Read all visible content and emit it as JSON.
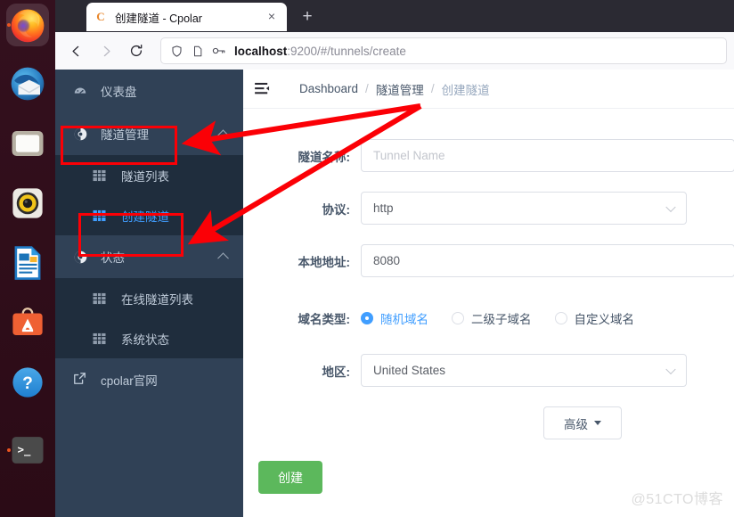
{
  "dock": {
    "items": [
      {
        "name": "firefox",
        "label": "Firefox",
        "running": true,
        "active": true
      },
      {
        "name": "thunderbird",
        "label": "Thunderbird Mail",
        "running": false,
        "active": false
      },
      {
        "name": "files",
        "label": "Files",
        "running": false,
        "active": false
      },
      {
        "name": "rhythmbox",
        "label": "Rhythmbox",
        "running": false,
        "active": false
      },
      {
        "name": "libreoffice-impress",
        "label": "LibreOffice Impress",
        "running": false,
        "active": false
      },
      {
        "name": "app-center",
        "label": "App Center",
        "running": false,
        "active": false
      },
      {
        "name": "help",
        "label": "Help",
        "running": false,
        "active": false
      },
      {
        "name": "terminal",
        "label": "Terminal",
        "running": true,
        "active": false
      }
    ]
  },
  "browser": {
    "tab": {
      "favicon_letter": "C",
      "title": "创建隧道 - Cpolar",
      "close_glyph": "×"
    },
    "new_tab_glyph": "+",
    "nav": {
      "back_glyph": "←",
      "forward_glyph": "→",
      "reload_glyph": "↻"
    },
    "url": {
      "host": "localhost",
      "rest": ":9200/#/tunnels/create",
      "full": "localhost:9200/#/tunnels/create"
    }
  },
  "sidebar": {
    "items": [
      {
        "label": "仪表盘",
        "icon": "dashboard-icon",
        "type": "group",
        "active": false
      },
      {
        "label": "隧道管理",
        "icon": "compass-icon",
        "type": "group",
        "expanded": true,
        "active": false
      },
      {
        "label": "隧道列表",
        "icon": "grid-icon",
        "type": "sub",
        "active": false
      },
      {
        "label": "创建隧道",
        "icon": "grid-icon",
        "type": "sub",
        "active": true
      },
      {
        "label": "状态",
        "icon": "compass-icon",
        "type": "group",
        "expanded": true,
        "active": false
      },
      {
        "label": "在线隧道列表",
        "icon": "grid-icon",
        "type": "sub",
        "active": false
      },
      {
        "label": "系统状态",
        "icon": "grid-icon",
        "type": "sub",
        "active": false
      },
      {
        "label": "cpolar官网",
        "icon": "external-link-icon",
        "type": "plain",
        "active": false
      }
    ]
  },
  "breadcrumb": {
    "sep": "/",
    "items": [
      {
        "label": "Dashboard",
        "current": false
      },
      {
        "label": "隧道管理",
        "current": false
      },
      {
        "label": "创建隧道",
        "current": true
      }
    ]
  },
  "form": {
    "tunnel_name": {
      "label": "隧道名称:",
      "value": "",
      "placeholder": "Tunnel Name"
    },
    "protocol": {
      "label": "协议:",
      "value": "http"
    },
    "local_addr": {
      "label": "本地地址:",
      "value": "8080"
    },
    "domain_type": {
      "label": "域名类型:",
      "options": [
        {
          "label": "随机域名",
          "selected": true
        },
        {
          "label": "二级子域名",
          "selected": false
        },
        {
          "label": "自定义域名",
          "selected": false
        }
      ]
    },
    "region": {
      "label": "地区:",
      "value": "United States"
    },
    "advanced_button": "高级",
    "create_button": "创建"
  },
  "watermark": "@51CTO博客",
  "colors": {
    "sidebar_bg": "#304156",
    "submenu_bg": "#1f2d3d",
    "accent_blue": "#409eff",
    "create_green": "#5cb85c",
    "annotation_red": "#fb0006",
    "tabstrip_bg": "#2b2a33"
  }
}
